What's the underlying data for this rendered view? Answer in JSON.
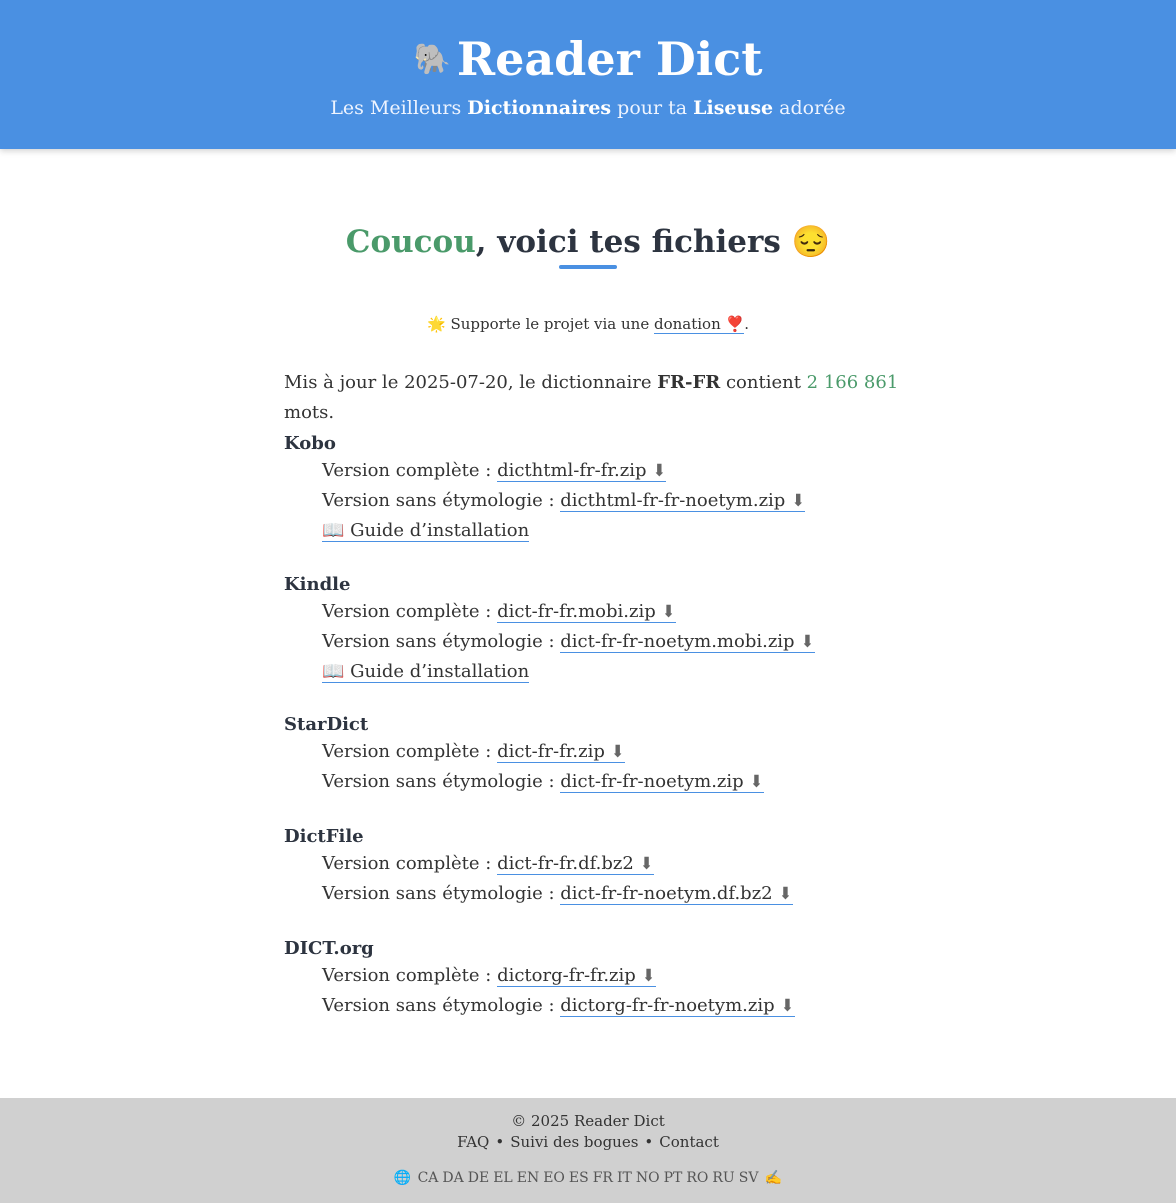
{
  "header": {
    "logo_icon": "🐘",
    "title": "Reader Dict",
    "tagline": [
      "Les Meilleurs ",
      "Dictionnaires",
      " pour ta ",
      "Liseuse",
      " adorée"
    ]
  },
  "heading": {
    "hello": "Coucou",
    "rest": ", voici tes fichiers ",
    "emoji": "😔"
  },
  "support": {
    "star": "🌟",
    "text": " Supporte le projet via une ",
    "link": "donation ",
    "heart": "❣️",
    "end": "."
  },
  "stats": {
    "prefix": "Mis à jour le ",
    "date": "2025-07-20",
    "mid": ", le dictionnaire ",
    "locale": "FR-FR",
    "mid2": " contient ",
    "count": "2 166 861",
    "suffix": " mots."
  },
  "labels": {
    "full": "Version complète : ",
    "noetym": "Version sans étymologie : ",
    "guide_icon": "📖",
    "guide": " Guide d’installation",
    "download_icon": "⬇"
  },
  "platforms": [
    {
      "name": "Kobo",
      "full": "dicthtml-fr-fr.zip ",
      "noetym": "dicthtml-fr-fr-noetym.zip ",
      "guide": true
    },
    {
      "name": "Kindle",
      "full": "dict-fr-fr.mobi.zip ",
      "noetym": "dict-fr-fr-noetym.mobi.zip ",
      "guide": true
    },
    {
      "name": "StarDict",
      "full": "dict-fr-fr.zip ",
      "noetym": "dict-fr-fr-noetym.zip ",
      "guide": false
    },
    {
      "name": "DictFile",
      "full": "dict-fr-fr.df.bz2 ",
      "noetym": "dict-fr-fr-noetym.df.bz2 ",
      "guide": false
    },
    {
      "name": "DICT.org",
      "full": "dictorg-fr-fr.zip ",
      "noetym": "dictorg-fr-fr-noetym.zip ",
      "guide": false
    }
  ],
  "footer": {
    "copyright": "© 2025 Reader Dict",
    "links": [
      "FAQ",
      "Suivi des bogues",
      "Contact"
    ],
    "separator": "•",
    "globe_icon": "🌐",
    "languages": [
      "CA",
      "DA",
      "DE",
      "EL",
      "EN",
      "EO",
      "ES",
      "FR",
      "IT",
      "NO",
      "PT",
      "RO",
      "RU",
      "SV"
    ],
    "writing_icon": "✍️"
  }
}
